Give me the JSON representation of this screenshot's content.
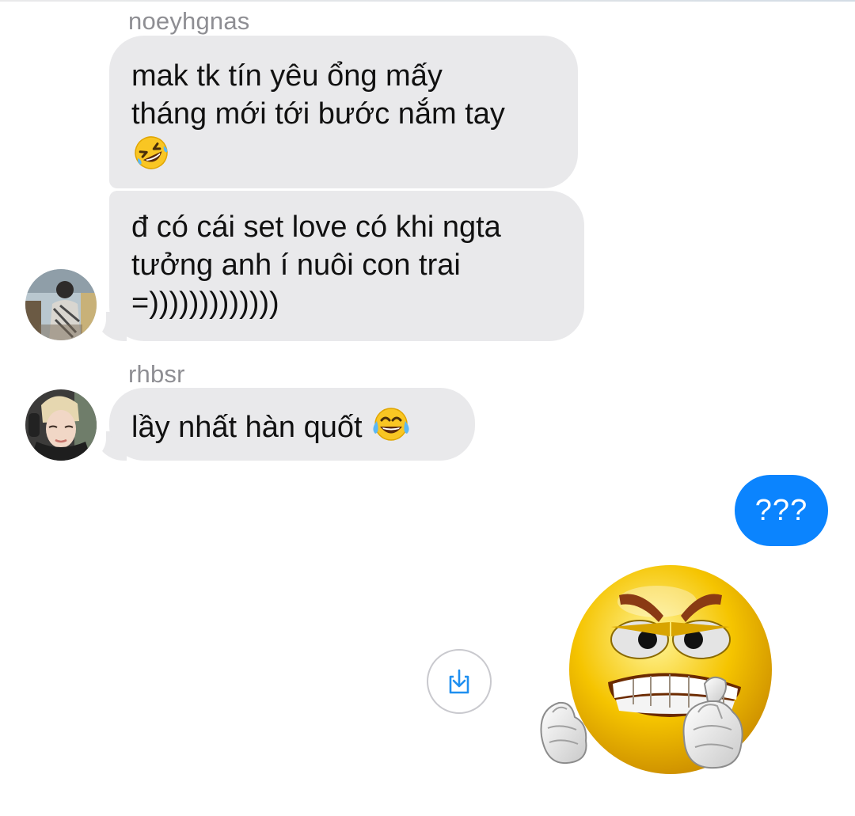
{
  "conversation": {
    "messages": [
      {
        "sender": "noeyhgnas",
        "lines": [
          "mak tk tín yêu ổng mấy",
          "tháng mới tới bước nắm tay"
        ],
        "emoji": "rolling-on-floor-laughing-emoji"
      },
      {
        "lines": [
          "đ có cái set love có khi ngta",
          "tưởng anh í nuôi con trai",
          "=)))))))))))))"
        ]
      },
      {
        "sender": "rhbsr",
        "text": "lầy nhất hàn quốt",
        "emoji": "tears-of-joy-emoji"
      }
    ],
    "sent": [
      {
        "text": "???"
      }
    ],
    "sticker": {
      "icon": "angry-grinning-face-sticker"
    }
  },
  "colors": {
    "incoming_bubble": "#e9e9eb",
    "outgoing_bubble": "#0b84fe",
    "sender_name": "#8e8e93"
  },
  "icons": {
    "save": "save-download-icon"
  }
}
